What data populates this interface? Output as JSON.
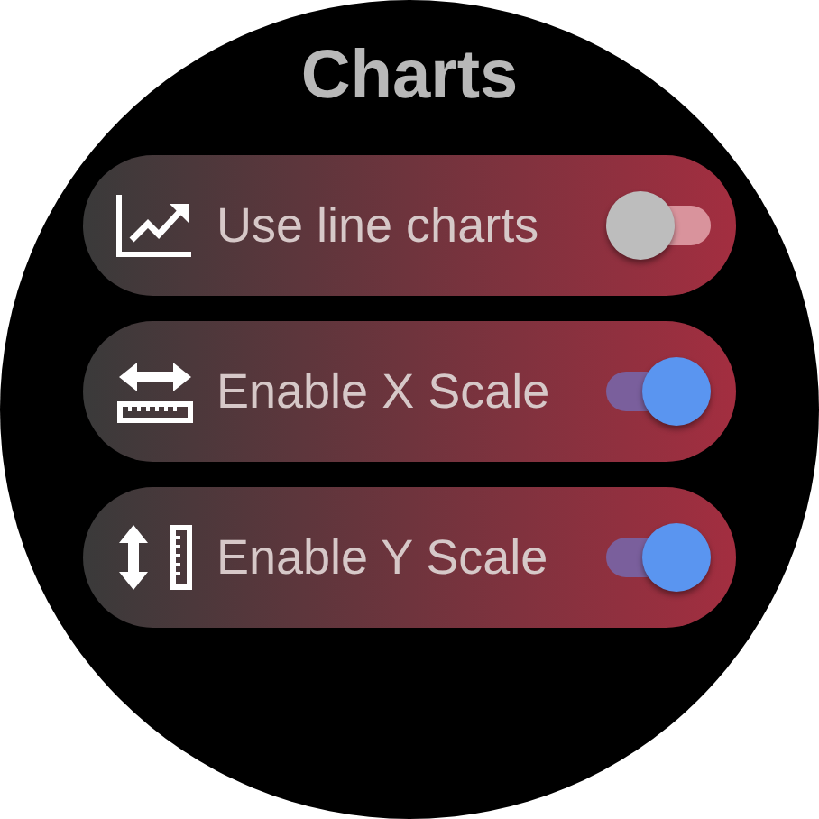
{
  "title": "Charts",
  "settings": [
    {
      "label": "Use line charts",
      "on": false
    },
    {
      "label": "Enable X Scale",
      "on": true
    },
    {
      "label": "Enable Y Scale",
      "on": true
    }
  ]
}
